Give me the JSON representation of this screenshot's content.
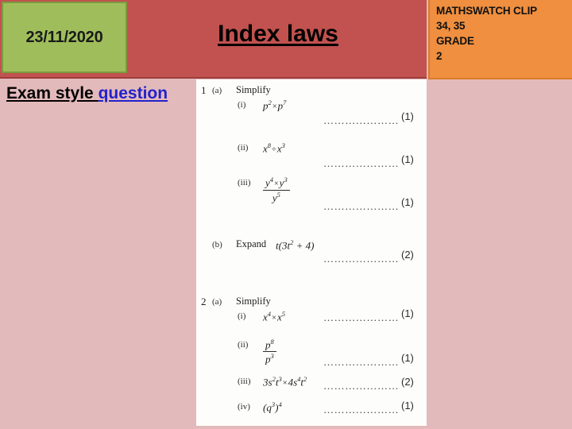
{
  "slide": {
    "date": "23/11/2020",
    "title": "Index laws",
    "exam_style_prefix": "Exam style ",
    "exam_style_link": "question",
    "colors": {
      "background": "#E3BABB",
      "header_band": "#C1524F",
      "date_box": "#9FBE5B",
      "date_box_border": "#7D9A3E",
      "clip_panel": "#EF8F3F",
      "link_blue": "#2222CC",
      "worksheet_paper": "#FDFDFC"
    }
  },
  "clip_panel": {
    "lines": [
      "MATHSWATCH CLIP",
      "34, 35",
      "GRADE",
      "2"
    ]
  },
  "worksheet": {
    "questions": [
      {
        "number": "1",
        "part": "(a)",
        "instruction": "Simplify",
        "items": [
          {
            "roman": "(i)",
            "expr_html": "<i>p</i><sup>2</sup><span class='op'>&#215;</span><i>p</i><sup>7</sup>",
            "expr_text": "p^2 x p^7",
            "marks": "(1)"
          },
          {
            "roman": "(ii)",
            "expr_html": "<i>x</i><sup>8</sup><span class='op'>&#247;</span><i>x</i><sup>3</sup>",
            "expr_text": "x^8 / x^3",
            "marks": "(1)"
          },
          {
            "roman": "(iii)",
            "expr_html": "FRAC:<i>y</i><sup>4</sup><span class='op'>&#215;</span><i>y</i><sup>3</sup>|<i>y</i><sup>5</sup>",
            "expr_text": "(y^4 x y^3) / y^5",
            "marks": "(1)"
          }
        ]
      },
      {
        "number": "",
        "part": "(b)",
        "instruction": "Expand",
        "items": [
          {
            "roman": "",
            "expr_html": "<i>t</i>(3<i>t</i><sup>2</sup> + 4)",
            "expr_text": "t(3t^2 + 4)",
            "marks": "(2)"
          }
        ]
      },
      {
        "number": "2",
        "part": "(a)",
        "instruction": "Simplify",
        "items": [
          {
            "roman": "(i)",
            "expr_html": "<i>x</i><sup>4</sup><span class='op'>&#215;</span><i>x</i><sup>5</sup>",
            "expr_text": "x^4 x x^5",
            "marks": "(1)"
          },
          {
            "roman": "(ii)",
            "expr_html": "FRAC:<i>p</i><sup>8</sup>|<i>p</i><sup>3</sup>",
            "expr_text": "p^8 / p^3",
            "marks": "(1)"
          },
          {
            "roman": "(iii)",
            "expr_html": "3<i>s</i><sup>2</sup><i>t</i><sup>3</sup><span class='op'>&#215;</span>4<i>s</i><sup>4</sup><i>t</i><sup>2</sup>",
            "expr_text": "3s^2t^3 x 4s^4t^2",
            "marks": "(2)"
          },
          {
            "roman": "(iv)",
            "expr_html": "(<i>q</i><sup>3</sup>)<sup>4</sup>",
            "expr_text": "(q^3)^4",
            "marks": "(1)"
          }
        ]
      }
    ],
    "dot_leader": "……………………"
  }
}
